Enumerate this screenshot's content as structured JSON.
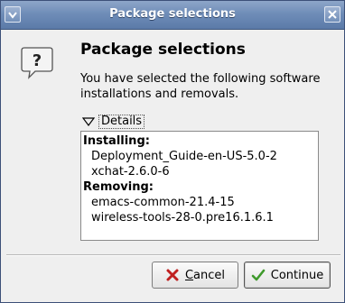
{
  "window": {
    "title": "Package selections",
    "menu_button": "window-menu",
    "close_button": "close"
  },
  "dialog": {
    "icon": "question-icon",
    "heading": "Package selections",
    "message": "You have selected the following software installations and removals.",
    "details_label": "Details",
    "details_expanded": true,
    "details": {
      "installing_label": "Installing:",
      "installing": [
        "Deployment_Guide-en-US-5.0-2",
        "xchat-2.6.0-6"
      ],
      "removing_label": "Removing:",
      "removing": [
        "emacs-common-21.4-15",
        "wireless-tools-28-0.pre16.1.6.1"
      ]
    }
  },
  "buttons": {
    "cancel_label": "Cancel",
    "cancel_mnemonic": "C",
    "cancel_rest": "ancel",
    "continue_label": "Continue"
  },
  "colors": {
    "titlebar": "#6f8db8",
    "background": "#efefef",
    "cancel_icon": "#c02020",
    "continue_icon": "#3f9a2c"
  }
}
